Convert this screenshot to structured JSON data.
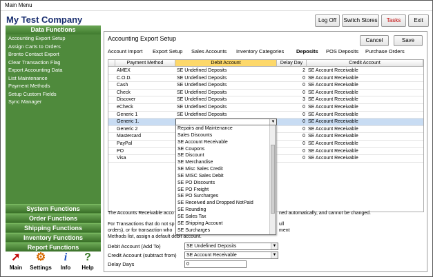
{
  "window": {
    "title": "Main Menu"
  },
  "company": "My Test Company",
  "top_buttons": {
    "logoff": "Log Off",
    "switch_stores": "Switch Stores",
    "tasks": "Tasks",
    "exit": "Exit"
  },
  "sidebar": {
    "header": "Data Functions",
    "items": [
      "Accounting Export Setup",
      "Assign Carts to Orders",
      "Bronto Contact Export",
      "Clear Transaction Flag",
      "Export Accounting Data",
      "List Maintenance",
      "Payment Methods",
      "Setup Custom Fields",
      "Sync Manager"
    ],
    "function_groups": [
      "System Functions",
      "Order Functions",
      "Shipping Functions",
      "Inventory Functions",
      "Report Functions"
    ]
  },
  "bottom_icons": [
    {
      "label": "Main",
      "icon": "main-icon"
    },
    {
      "label": "Settings",
      "icon": "settings-icon"
    },
    {
      "label": "Info",
      "icon": "info-icon"
    },
    {
      "label": "Help",
      "icon": "help-icon"
    }
  ],
  "panel": {
    "title": "Accounting Export Setup",
    "cancel": "Cancel",
    "save": "Save",
    "tabs": [
      "Account Import",
      "Export Setup",
      "Sales Accounts",
      "Inventory Categories",
      "Deposits",
      "POS Deposits",
      "Purchase Orders"
    ],
    "active_tab": "Deposits"
  },
  "grid": {
    "columns": [
      "Payment Method",
      "Debit Account",
      "Delay Day",
      "Credit Account"
    ],
    "rows": [
      {
        "method": "AMEX",
        "debit": "SE Undefined Deposits",
        "delay": "2",
        "credit": "SE Account Receivable"
      },
      {
        "method": "C.O.D.",
        "debit": "SE Undefined Deposits",
        "delay": "0",
        "credit": "SE Account Receivable"
      },
      {
        "method": "Cash",
        "debit": "SE Undefined Deposits",
        "delay": "0",
        "credit": "SE Account Receivable"
      },
      {
        "method": "Check",
        "debit": "SE Undefined Deposits",
        "delay": "0",
        "credit": "SE Account Receivable"
      },
      {
        "method": "Discover",
        "debit": "SE Undefined Deposits",
        "delay": "3",
        "credit": "SE Account Receivable"
      },
      {
        "method": "eCheck",
        "debit": "SE Undefined Deposits",
        "delay": "0",
        "credit": "SE Account Receivable"
      },
      {
        "method": "Generic 1",
        "debit": "SE Undefined Deposits",
        "delay": "0",
        "credit": "SE Account Receivable"
      },
      {
        "method": "Generic 1.",
        "debit": "",
        "delay": "0",
        "credit": "SE Account Receivable"
      },
      {
        "method": "Generic 2",
        "debit": "",
        "delay": "0",
        "credit": "SE Account Receivable"
      },
      {
        "method": "Mastercard",
        "debit": "",
        "delay": "0",
        "credit": "SE Account Receivable"
      },
      {
        "method": "PayPal",
        "debit": "",
        "delay": "0",
        "credit": "SE Account Receivable"
      },
      {
        "method": "PO",
        "debit": "",
        "delay": "0",
        "credit": "SE Account Receivable"
      },
      {
        "method": "Visa",
        "debit": "",
        "delay": "0",
        "credit": "SE Account Receivable"
      }
    ],
    "selected_row": 7
  },
  "dropdown": {
    "items": [
      "Repairs and Maintenance",
      "Sales Discounts",
      "SE Account Receivable",
      "SE Coupons",
      "SE Discount",
      "SE Merchandise",
      "SE Misc Sales Credit",
      "SE MISC Sales Debit",
      "SE PO Discounts",
      "SE PO Freight",
      "SE PO Surcharges",
      "SE Received and Dropped NotPaid",
      "SE Rounding",
      "SE Sales Tax",
      "SE Shipping Account",
      "SE Surcharges"
    ]
  },
  "info": {
    "line1_left": "The Accounts Receivable acco",
    "line1_right": "ned automatically, and cannot be changed.",
    "line2_left": "For Transactions that do not sp",
    "line2_right": "ull",
    "line3_left": "orders), or for transaction who",
    "line3_right": "ment",
    "line4": "Methods list, assign a default debit account."
  },
  "form": {
    "debit_label": "Debit Account (Add To)",
    "debit_value": "SE Undefined Deposits",
    "credit_label": "Credit Account (subtract from)",
    "credit_value": "SE Account Receivable",
    "delay_label": "Delay Days",
    "delay_value": "0"
  }
}
